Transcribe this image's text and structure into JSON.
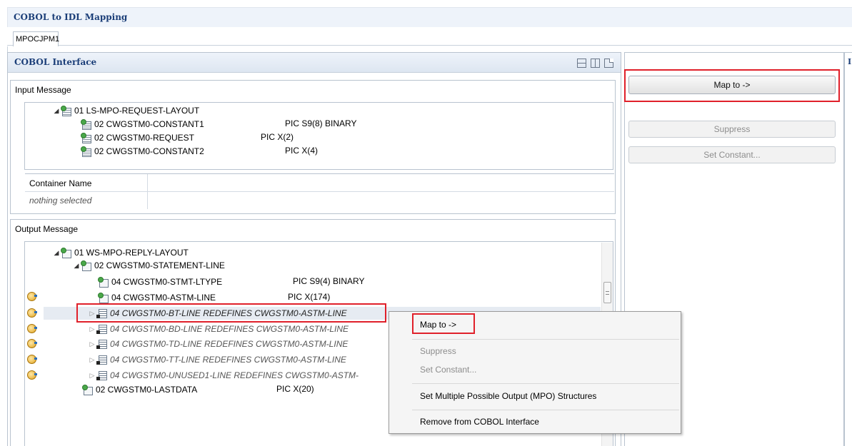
{
  "window": {
    "title": "COBOL to IDL Mapping"
  },
  "tab": {
    "label": "MPOCJPM1"
  },
  "cobol_panel": {
    "title": "COBOL Interface"
  },
  "view_icons": [
    "horizontal-layout-icon",
    "vertical-layout-icon",
    "single-layout-icon"
  ],
  "right_panel": {
    "edge_label": "I"
  },
  "input_message": {
    "label": "Input Message",
    "tree": [
      {
        "name": "01 LS-MPO-REQUEST-LAYOUT",
        "pic": ""
      },
      {
        "name": "02 CWGSTM0-CONSTANT1",
        "pic": "PIC S9(8) BINARY"
      },
      {
        "name": "02 CWGSTM0-REQUEST",
        "pic": "PIC X(2)"
      },
      {
        "name": "02 CWGSTM0-CONSTANT2",
        "pic": "PIC X(4)"
      }
    ]
  },
  "container_table": {
    "header": "Container Name",
    "empty_text": "nothing selected"
  },
  "output_message": {
    "label": "Output Message",
    "tree": [
      {
        "name": "01 WS-MPO-REPLY-LAYOUT",
        "pic": ""
      },
      {
        "name": "02 CWGSTM0-STATEMENT-LINE",
        "pic": ""
      },
      {
        "name": "04 CWGSTM0-STMT-LTYPE",
        "pic": "PIC S9(4) BINARY"
      },
      {
        "name": "04 CWGSTM0-ASTM-LINE",
        "pic": "PIC X(174)"
      },
      {
        "name": "04 CWGSTM0-BT-LINE REDEFINES CWGSTM0-ASTM-LINE",
        "pic": ""
      },
      {
        "name": "04 CWGSTM0-BD-LINE REDEFINES CWGSTM0-ASTM-LINE",
        "pic": ""
      },
      {
        "name": "04 CWGSTM0-TD-LINE REDEFINES CWGSTM0-ASTM-LINE",
        "pic": ""
      },
      {
        "name": "04 CWGSTM0-TT-LINE REDEFINES CWGSTM0-ASTM-LINE",
        "pic": ""
      },
      {
        "name": "04 CWGSTM0-UNUSED1-LINE REDEFINES CWGSTM0-ASTM-",
        "pic": ""
      },
      {
        "name": "02 CWGSTM0-LASTDATA",
        "pic": "PIC X(20)"
      }
    ]
  },
  "actions": {
    "map_to": "Map to ->",
    "suppress": "Suppress",
    "set_constant": "Set Constant..."
  },
  "context_menu": {
    "items": [
      {
        "label": "Map to ->",
        "enabled": true
      },
      {
        "label": "Suppress",
        "enabled": false
      },
      {
        "label": "Set Constant...",
        "enabled": false
      },
      {
        "label": "Set Multiple Possible Output (MPO) Structures",
        "enabled": true
      },
      {
        "label": "Remove from COBOL Interface",
        "enabled": true
      }
    ]
  },
  "colors": {
    "highlight_box": "#e0202a",
    "header_text": "#1b3e78"
  }
}
